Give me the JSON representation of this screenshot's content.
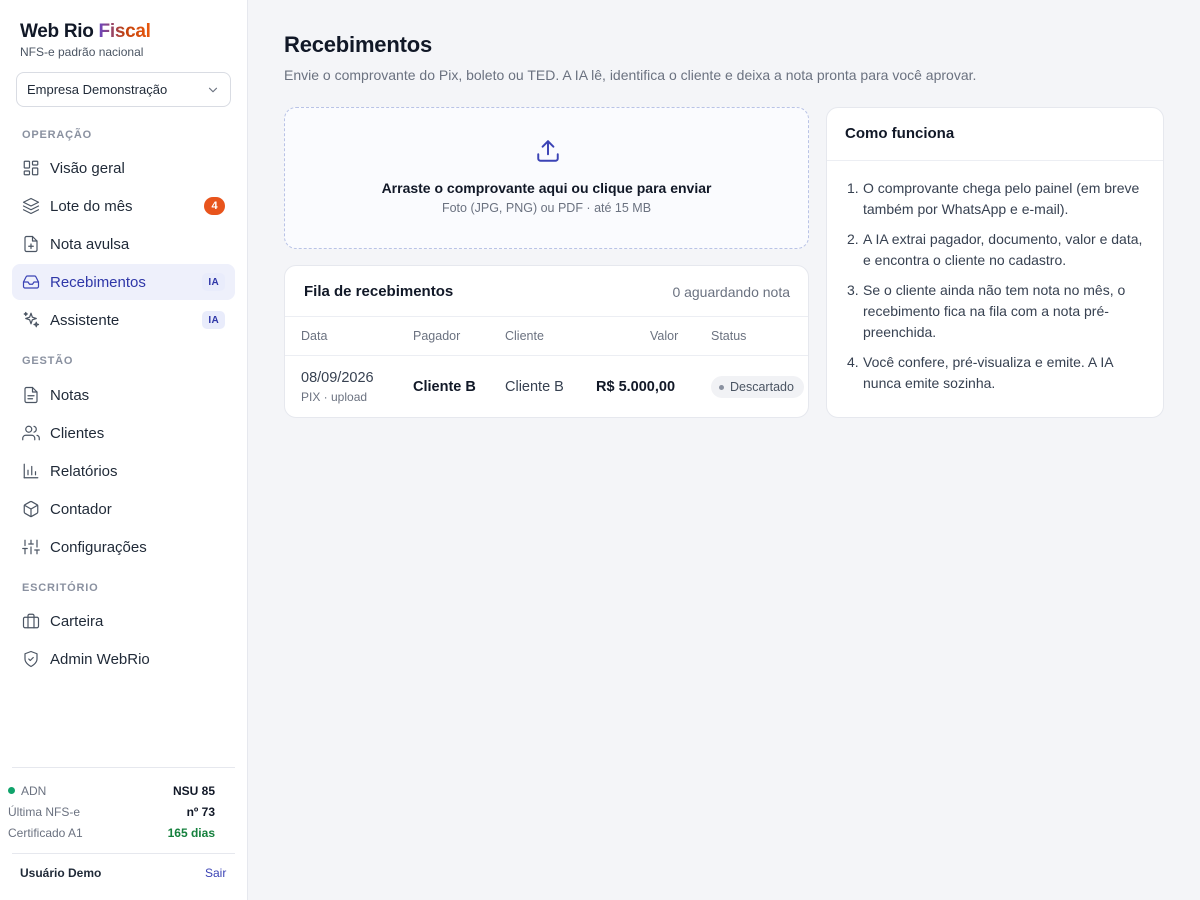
{
  "brand": {
    "name_part1": "Web Rio ",
    "name_part2": "Fiscal",
    "subtitle": "NFS-e padrão nacional"
  },
  "company_selector": {
    "value": "Empresa Demonstração"
  },
  "sidebar": {
    "sections": [
      {
        "label": "OPERAÇÃO"
      },
      {
        "label": "GESTÃO"
      },
      {
        "label": "ESCRITÓRIO"
      }
    ],
    "items": [
      {
        "label": "Visão geral",
        "icon": "grid-icon"
      },
      {
        "label": "Lote do mês",
        "icon": "layers-icon",
        "badge": "4"
      },
      {
        "label": "Nota avulsa",
        "icon": "file-plus-icon"
      },
      {
        "label": "Recebimentos",
        "icon": "inbox-icon",
        "badge": "IA",
        "active": true
      },
      {
        "label": "Assistente",
        "icon": "sparkles-icon",
        "badge": "IA"
      },
      {
        "label": "Notas",
        "icon": "file-text-icon"
      },
      {
        "label": "Clientes",
        "icon": "users-icon"
      },
      {
        "label": "Relatórios",
        "icon": "bar-chart-icon"
      },
      {
        "label": "Contador",
        "icon": "box-icon"
      },
      {
        "label": "Configurações",
        "icon": "sliders-icon"
      },
      {
        "label": "Carteira",
        "icon": "briefcase-icon"
      },
      {
        "label": "Admin WebRio",
        "icon": "shield-icon"
      }
    ],
    "footer": {
      "adn_label": "ADN",
      "adn_value": "NSU 85",
      "last_label": "Última NFS-e",
      "last_value": "nº 73",
      "cert_label": "Certificado A1",
      "cert_value": "165 dias",
      "user": "Usuário Demo",
      "logout": "Sair"
    }
  },
  "main": {
    "title": "Recebimentos",
    "subtitle": "Envie o comprovante do Pix, boleto ou TED. A IA lê, identifica o cliente e deixa a nota pronta para você aprovar.",
    "upload": {
      "title": "Arraste o comprovante aqui ou clique para enviar",
      "hint": "Foto (JPG, PNG) ou PDF · até 15 MB"
    },
    "queue": {
      "title": "Fila de recebimentos",
      "count": "0 aguardando nota",
      "columns": [
        "Data",
        "Pagador",
        "Cliente",
        "Valor",
        "Status"
      ],
      "rows": [
        {
          "date": "08/09/2026",
          "method": "PIX · upload",
          "payer": "Cliente B",
          "client": "Cliente B",
          "value": "R$ 5.000,00",
          "status": "Descartado"
        }
      ]
    },
    "how": {
      "title": "Como funciona",
      "steps": [
        {
          "n": "1.",
          "text": "O comprovante chega pelo painel (em breve também por WhatsApp e e-mail)."
        },
        {
          "n": "2.",
          "text": "A IA extrai pagador, documento, valor e data, e encontra o cliente no cadastro."
        },
        {
          "n": "3.",
          "text": "Se o cliente ainda não tem nota no mês, o recebimento fica na fila com a nota pré-preenchida."
        },
        {
          "n": "4.",
          "text": "Você confere, pré-visualiza e emite. A IA nunca emite sozinha."
        }
      ]
    }
  }
}
